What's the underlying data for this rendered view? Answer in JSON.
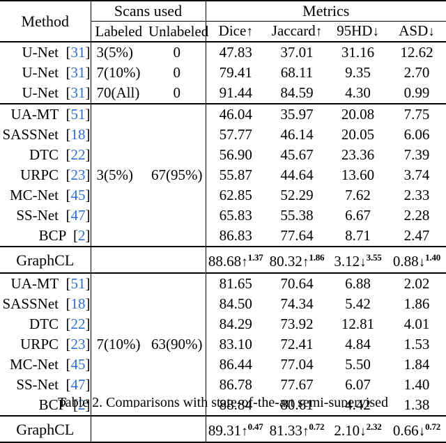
{
  "table": {
    "headers": {
      "method": "Method",
      "scans_used": "Scans used",
      "labeled": "Labeled",
      "unlabeled": "Unlabeled",
      "metrics": "Metrics",
      "dice": "Dice",
      "dice_arrow": "↑",
      "jaccard": "Jaccard",
      "jaccard_arrow": "↑",
      "hd95": "95HD",
      "hd95_arrow": "↓",
      "asd": "ASD",
      "asd_arrow": "↓"
    },
    "groups": [
      {
        "id": "supervised",
        "scans_span": null,
        "rows": [
          {
            "method": "U-Net",
            "ref": "31",
            "labeled": "3(5%)",
            "unlabeled": "0",
            "dice": "47.83",
            "jaccard": "37.01",
            "hd95": "31.16",
            "asd": "12.62",
            "highlight": false
          },
          {
            "method": "U-Net",
            "ref": "31",
            "labeled": "7(10%)",
            "unlabeled": "0",
            "dice": "79.41",
            "jaccard": "68.11",
            "hd95": "9.35",
            "asd": "2.70",
            "highlight": false
          },
          {
            "method": "U-Net",
            "ref": "31",
            "labeled": "70(All)",
            "unlabeled": "0",
            "dice": "91.44",
            "jaccard": "84.59",
            "hd95": "4.30",
            "asd": "0.99",
            "highlight": false
          }
        ]
      },
      {
        "id": "semi-5pct",
        "scans_span": {
          "labeled": "3(5%)",
          "unlabeled": "67(95%)"
        },
        "rows": [
          {
            "method": "UA-MT",
            "ref": "51",
            "dice": "46.04",
            "jaccard": "35.97",
            "hd95": "20.08",
            "asd": "7.75",
            "highlight": false
          },
          {
            "method": "SASSNet",
            "ref": "18",
            "dice": "57.77",
            "jaccard": "46.14",
            "hd95": "20.05",
            "asd": "6.06",
            "highlight": false
          },
          {
            "method": "DTC",
            "ref": "22",
            "dice": "56.90",
            "jaccard": "45.67",
            "hd95": "23.36",
            "asd": "7.39",
            "highlight": false
          },
          {
            "method": "URPC",
            "ref": "23",
            "dice": "55.87",
            "jaccard": "44.64",
            "hd95": "13.60",
            "asd": "3.74",
            "highlight": false
          },
          {
            "method": "MC-Net",
            "ref": "45",
            "dice": "62.85",
            "jaccard": "52.29",
            "hd95": "7.62",
            "asd": "2.33",
            "highlight": false
          },
          {
            "method": "SS-Net",
            "ref": "47",
            "dice": "65.83",
            "jaccard": "55.38",
            "hd95": "6.67",
            "asd": "2.28",
            "highlight": false
          },
          {
            "method": "BCP",
            "ref": "2",
            "dice": "86.83",
            "jaccard": "77.64",
            "hd95": "8.71",
            "asd": "2.47",
            "highlight": false
          }
        ],
        "result": {
          "method": "GraphCL",
          "ref": null,
          "dice": "88.68",
          "dice_arrow": "↑",
          "dice_delta": "1.37",
          "jaccard": "80.32",
          "jaccard_arrow": "↑",
          "jaccard_delta": "1.86",
          "hd95": "3.12",
          "hd95_arrow": "↓",
          "hd95_delta": "3.55",
          "asd": "0.88",
          "asd_arrow": "↓",
          "asd_delta": "1.40"
        }
      },
      {
        "id": "semi-10pct",
        "scans_span": {
          "labeled": "7(10%)",
          "unlabeled": "63(90%)"
        },
        "rows": [
          {
            "method": "UA-MT",
            "ref": "51",
            "dice": "81.65",
            "jaccard": "70.64",
            "hd95": "6.88",
            "asd": "2.02",
            "highlight": false
          },
          {
            "method": "SASSNet",
            "ref": "18",
            "dice": "84.50",
            "jaccard": "74.34",
            "hd95": "5.42",
            "asd": "1.86",
            "highlight": false
          },
          {
            "method": "DTC",
            "ref": "22",
            "dice": "84.29",
            "jaccard": "73.92",
            "hd95": "12.81",
            "asd": "4.01",
            "highlight": false
          },
          {
            "method": "URPC",
            "ref": "23",
            "dice": "83.10",
            "jaccard": "72.41",
            "hd95": "4.84",
            "asd": "1.53",
            "highlight": false
          },
          {
            "method": "MC-Net",
            "ref": "45",
            "dice": "86.44",
            "jaccard": "77.04",
            "hd95": "5.50",
            "asd": "1.84",
            "highlight": false
          },
          {
            "method": "SS-Net",
            "ref": "47",
            "dice": "86.78",
            "jaccard": "77.67",
            "hd95": "6.07",
            "asd": "1.40",
            "highlight": false
          },
          {
            "method": "BCP",
            "ref": "2",
            "dice": "88.84",
            "jaccard": "80.61",
            "hd95": "4.42",
            "asd": "1.38",
            "highlight": false
          }
        ],
        "result": {
          "method": "GraphCL",
          "ref": null,
          "dice": "89.31",
          "dice_arrow": "↑",
          "dice_delta": "0.47",
          "jaccard": "81.33",
          "jaccard_arrow": "↑",
          "jaccard_delta": "0.72",
          "hd95": "2.10",
          "hd95_arrow": "↓",
          "hd95_delta": "2.32",
          "asd": "0.66",
          "asd_arrow": "↓",
          "asd_delta": "0.72"
        }
      }
    ]
  },
  "caption": {
    "text": "Table 2. Comparisons with state-of-the-art semi-supervised"
  },
  "colors": {
    "reference_link": "#2f6fd0",
    "rule": "#000000",
    "text": "#000000",
    "background": "#ffffff"
  }
}
